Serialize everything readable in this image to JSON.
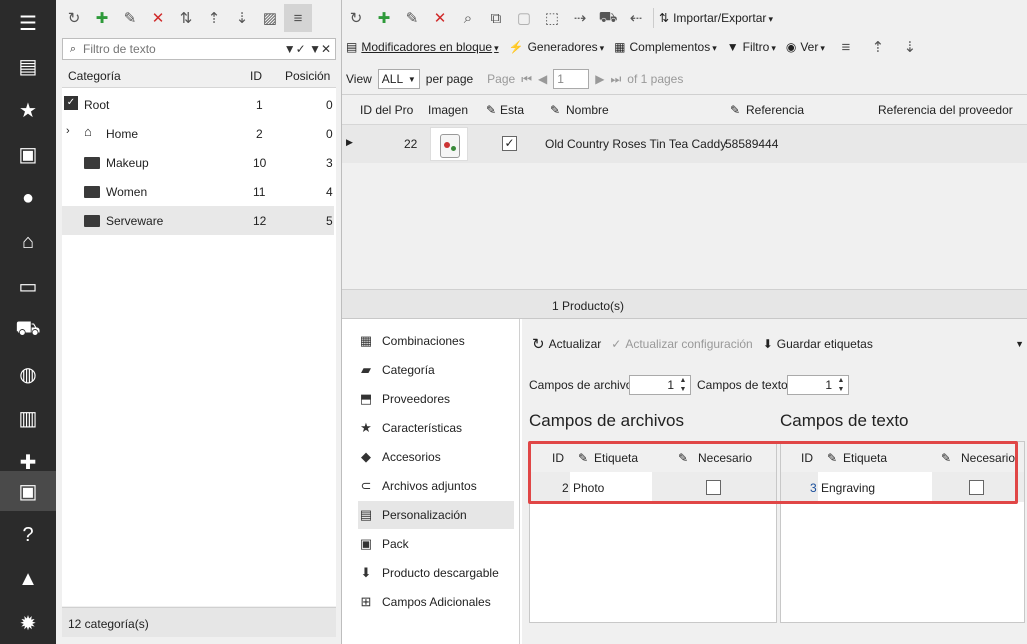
{
  "rail": {
    "items": [
      {
        "icon": "menu-icon",
        "glyph": "☰"
      },
      {
        "icon": "store-icon",
        "glyph": "▤"
      },
      {
        "icon": "star-icon",
        "glyph": "★"
      },
      {
        "icon": "inbox-icon",
        "glyph": "▣"
      },
      {
        "icon": "user-icon",
        "glyph": "●"
      },
      {
        "icon": "basket-icon",
        "glyph": "⌂"
      },
      {
        "icon": "message-icon",
        "glyph": "▭"
      },
      {
        "icon": "truck-icon",
        "glyph": "⛟"
      },
      {
        "icon": "globe-icon",
        "glyph": "◍"
      },
      {
        "icon": "chart-icon",
        "glyph": "▥"
      },
      {
        "icon": "puzzle-icon",
        "glyph": "✚"
      },
      {
        "icon": "box-icon",
        "glyph": "▣"
      },
      {
        "icon": "help-icon",
        "glyph": "?"
      },
      {
        "icon": "lock-icon",
        "glyph": "▲"
      },
      {
        "icon": "settings-icon",
        "glyph": "✹"
      }
    ]
  },
  "left": {
    "filter_placeholder": "Filtro de texto",
    "columns": {
      "category": "Categoría",
      "id": "ID",
      "position": "Posición"
    },
    "rows": [
      {
        "name": "Root",
        "id": "1",
        "pos": "0"
      },
      {
        "name": "Home",
        "id": "2",
        "pos": "0"
      },
      {
        "name": "Makeup",
        "id": "10",
        "pos": "3"
      },
      {
        "name": "Women",
        "id": "11",
        "pos": "4"
      },
      {
        "name": "Serveware",
        "id": "12",
        "pos": "5"
      }
    ],
    "status": "12 categoría(s)"
  },
  "top_toolbar": {
    "import_export": "Importar/Exportar"
  },
  "second_toolbar": {
    "bulk": "Modificadores en bloque",
    "generators": "Generadores",
    "addons": "Complementos",
    "filter": "Filtro",
    "view": "Ver"
  },
  "pager": {
    "view_label": "View",
    "view_value": "ALL",
    "per_page": "per page",
    "page_label": "Page",
    "page_value": "1",
    "of_pages": "of 1 pages"
  },
  "products": {
    "columns": {
      "id": "ID del Pro",
      "image": "Imagen",
      "status": "Esta",
      "name": "Nombre",
      "reference": "Referencia",
      "supplier_ref": "Referencia del proveedor"
    },
    "rows": [
      {
        "id": "22",
        "name": "Old Country Roses Tin Tea Caddy",
        "reference": "58589444"
      }
    ],
    "status": "1 Producto(s)"
  },
  "sidenav": {
    "items": [
      {
        "label": "Combinaciones",
        "icon": "grid-icon",
        "glyph": "▦"
      },
      {
        "label": "Categoría",
        "icon": "folder-check-icon",
        "glyph": "▰"
      },
      {
        "label": "Proveedores",
        "icon": "supplier-icon",
        "glyph": "⬒"
      },
      {
        "label": "Características",
        "icon": "star-icon",
        "glyph": "★"
      },
      {
        "label": "Accesorios",
        "icon": "gem-icon",
        "glyph": "◆"
      },
      {
        "label": "Archivos adjuntos",
        "icon": "paperclip-icon",
        "glyph": "⊂"
      },
      {
        "label": "Personalización",
        "icon": "custom-icon",
        "glyph": "▤"
      },
      {
        "label": "Pack",
        "icon": "pack-icon",
        "glyph": "▣"
      },
      {
        "label": "Producto descargable",
        "icon": "download-icon",
        "glyph": "⬇"
      },
      {
        "label": "Campos Adicionales",
        "icon": "add-fields-icon",
        "glyph": "⊞"
      }
    ]
  },
  "custom": {
    "refresh": "Actualizar",
    "refresh_config": "Actualizar configuración",
    "save_labels": "Guardar etiquetas",
    "file_fields_label": "Campos de archivo",
    "file_fields_value": "1",
    "text_fields_label": "Campos de texto",
    "text_fields_value": "1",
    "file_title": "Campos de archivos",
    "text_title": "Campos de texto",
    "col_id": "ID",
    "col_label": "Etiqueta",
    "col_required": "Necesario",
    "file_row": {
      "id": "2",
      "label": "Photo"
    },
    "text_row": {
      "id": "3",
      "label": "Engraving"
    }
  }
}
